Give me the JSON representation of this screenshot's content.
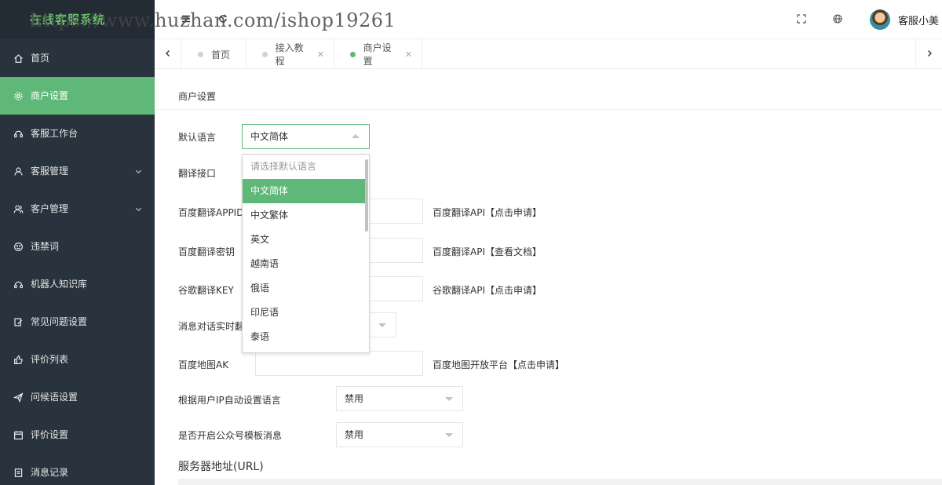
{
  "app": {
    "logo_text": "在线客服系统",
    "watermark": "https://www.huzhan.com/ishop19261"
  },
  "sidebar": {
    "items": [
      {
        "label": "首页",
        "icon": "home-icon"
      },
      {
        "label": "商户设置",
        "icon": "gear-icon",
        "active": true
      },
      {
        "label": "客服工作台",
        "icon": "headset-icon"
      },
      {
        "label": "客服管理",
        "icon": "user-icon",
        "expandable": true
      },
      {
        "label": "客户管理",
        "icon": "users-icon",
        "expandable": true
      },
      {
        "label": "违禁词",
        "icon": "smile-icon"
      },
      {
        "label": "机器人知识库",
        "icon": "robot-icon"
      },
      {
        "label": "常见问题设置",
        "icon": "edit-icon"
      },
      {
        "label": "评价列表",
        "icon": "thumbs-up-icon"
      },
      {
        "label": "问候语设置",
        "icon": "send-icon"
      },
      {
        "label": "评价设置",
        "icon": "calendar-icon"
      },
      {
        "label": "消息记录",
        "icon": "file-icon"
      }
    ]
  },
  "header": {
    "user_name": "客服小美"
  },
  "tabs": [
    {
      "label": "首页",
      "closable": false
    },
    {
      "label": "接入教程",
      "closable": true
    },
    {
      "label": "商户设置",
      "closable": true,
      "active": true
    }
  ],
  "form": {
    "card_title": "商户设置",
    "default_language": {
      "label": "默认语言",
      "value": "中文简体"
    },
    "translate_api": {
      "label": "翻译接口"
    },
    "baidu_appid": {
      "label": "百度翻译APPID",
      "link": "百度翻译API【点击申请】"
    },
    "baidu_secret": {
      "label": "百度翻译密钥",
      "link": "百度翻译API【查看文档】"
    },
    "google_key": {
      "label": "谷歌翻译KEY",
      "link": "谷歌翻译API【点击申请】"
    },
    "realtime_translate": {
      "label": "消息对话实时翻"
    },
    "baidu_map_ak": {
      "label": "百度地图AK",
      "link": "百度地图开放平台【点击申请】"
    },
    "auto_lang_by_ip": {
      "label": "根据用户IP自动设置语言",
      "value": "禁用"
    },
    "wechat_template": {
      "label": "是否开启公众号模板消息",
      "value": "禁用"
    },
    "server_url_title": "服务器地址(URL)"
  },
  "dropdown": {
    "placeholder": "请选择默认语言",
    "options": [
      "中文简体",
      "中文繁体",
      "英文",
      "越南语",
      "俄语",
      "印尼语",
      "泰语"
    ],
    "selected": "中文简体"
  },
  "colors": {
    "accent": "#5fb878",
    "sidebar_bg": "#28333e"
  }
}
